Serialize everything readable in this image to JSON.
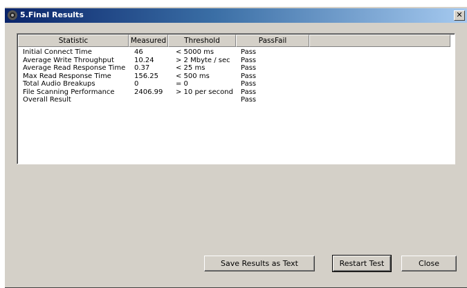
{
  "window": {
    "title": "5.Final Results",
    "close_glyph": "✕"
  },
  "table": {
    "columns": [
      "Statistic",
      "Measured",
      "Threshold",
      "PassFail",
      ""
    ],
    "rows": [
      [
        "Initial Connect Time",
        "46",
        "< 5000 ms",
        "Pass"
      ],
      [
        "Average Write Throughput",
        "10.24",
        "> 2 Mbyte / sec",
        "Pass"
      ],
      [
        "Average Read Response Time",
        "0.37",
        "< 25 ms",
        "Pass"
      ],
      [
        "Max Read Response Time",
        "156.25",
        "< 500 ms",
        "Pass"
      ],
      [
        "Total Audio Breakups",
        "0",
        "= 0",
        "Pass"
      ],
      [
        "File Scanning Performance",
        "2406.99",
        "> 10 per second",
        "Pass"
      ],
      [
        "Overall Result",
        "",
        "",
        "Pass"
      ]
    ]
  },
  "buttons": {
    "save_label": "Save Results as Text",
    "restart_label": "Restart Test",
    "close_label": "Close"
  }
}
